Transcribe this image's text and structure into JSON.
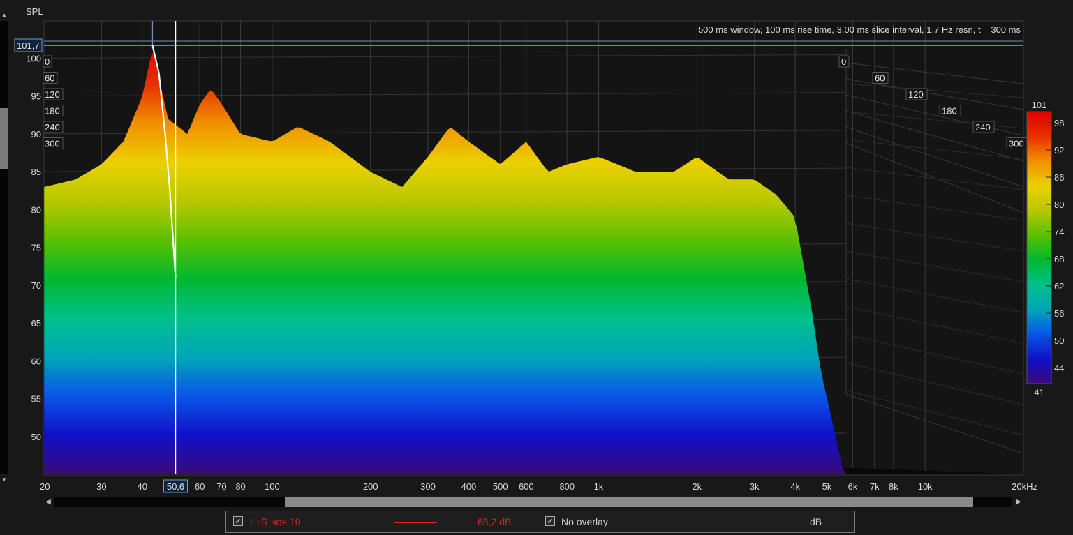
{
  "chart_data": {
    "type": "waterfall",
    "subtype": "3D spectral decay (area)",
    "yaxis_label": "SPL",
    "info_text": "500 ms window, 100 ms rise time, 3,00 ms slice interval, 1,7 Hz resn, t = 300 ms",
    "xlim": [
      20,
      20000
    ],
    "xscale": "log",
    "x_ticks": [
      {
        "v": 20,
        "t": "20"
      },
      {
        "v": 30,
        "t": "30"
      },
      {
        "v": 40,
        "t": "40"
      },
      {
        "v": 60,
        "t": "60"
      },
      {
        "v": 70,
        "t": "70"
      },
      {
        "v": 80,
        "t": "80"
      },
      {
        "v": 100,
        "t": "100"
      },
      {
        "v": 200,
        "t": "200"
      },
      {
        "v": 300,
        "t": "300"
      },
      {
        "v": 400,
        "t": "400"
      },
      {
        "v": 500,
        "t": "500"
      },
      {
        "v": 600,
        "t": "600"
      },
      {
        "v": 800,
        "t": "800"
      },
      {
        "v": 1000,
        "t": "1k"
      },
      {
        "v": 2000,
        "t": "2k"
      },
      {
        "v": 3000,
        "t": "3k"
      },
      {
        "v": 4000,
        "t": "4k"
      },
      {
        "v": 5000,
        "t": "5k"
      },
      {
        "v": 6000,
        "t": "6k"
      },
      {
        "v": 7000,
        "t": "7k"
      },
      {
        "v": 8000,
        "t": "8k"
      },
      {
        "v": 10000,
        "t": "10k"
      },
      {
        "v": 20000,
        "t": "20kHz"
      }
    ],
    "ylim": [
      45,
      102
    ],
    "y_ticks": [
      50,
      55,
      60,
      65,
      70,
      75,
      80,
      85,
      90,
      95,
      100
    ],
    "time_ticks_ms": [
      0,
      60,
      120,
      180,
      240,
      300
    ],
    "time_tick_labels": [
      "0",
      "60",
      "120",
      "180",
      "240",
      "300"
    ],
    "cursor": {
      "x": "50,6",
      "y": "101,7"
    },
    "cursor_freq_hz": 50.6,
    "cursor_spl": 101.7,
    "colorbar": {
      "min_label": "41",
      "max_label": "101",
      "ticks": [
        "98",
        "92",
        "86",
        "80",
        "74",
        "68",
        "62",
        "56",
        "50",
        "44"
      ],
      "colors": [
        "#3a0a7a",
        "#1010c8",
        "#0a55e8",
        "#00a6b8",
        "#00c08a",
        "#00b830",
        "#5ac000",
        "#b8c800",
        "#ecd000",
        "#f09000",
        "#e83000",
        "#e00000"
      ]
    },
    "front_slice_profile": [
      [
        20,
        83
      ],
      [
        25,
        84
      ],
      [
        30,
        86
      ],
      [
        35,
        89
      ],
      [
        40,
        95
      ],
      [
        43,
        101.5
      ],
      [
        48,
        92
      ],
      [
        55,
        90
      ],
      [
        60,
        94
      ],
      [
        65,
        96
      ],
      [
        70,
        94
      ],
      [
        80,
        90
      ],
      [
        100,
        89
      ],
      [
        120,
        91
      ],
      [
        150,
        89
      ],
      [
        200,
        85
      ],
      [
        250,
        83
      ],
      [
        300,
        87
      ],
      [
        350,
        91
      ],
      [
        400,
        89
      ],
      [
        500,
        86
      ],
      [
        600,
        89
      ],
      [
        700,
        85
      ],
      [
        800,
        86
      ],
      [
        1000,
        87
      ],
      [
        1300,
        85
      ],
      [
        1700,
        85
      ],
      [
        2000,
        87
      ],
      [
        2500,
        84
      ],
      [
        3000,
        84
      ],
      [
        3500,
        82
      ],
      [
        4000,
        79
      ],
      [
        4800,
        60
      ],
      [
        5500,
        52
      ],
      [
        6000,
        46
      ]
    ],
    "peaks_hz": [
      43,
      65,
      90,
      120,
      160,
      240,
      350,
      410,
      600,
      800,
      1100,
      1600,
      2100,
      3200
    ],
    "decay_cursor_trace": [
      [
        43,
        101.7
      ],
      [
        45,
        98
      ],
      [
        47,
        90
      ],
      [
        48.5,
        83
      ],
      [
        49.5,
        77
      ],
      [
        50.6,
        71
      ]
    ]
  },
  "legend_bar": {
    "measurement_name": "L+R ноя 10",
    "measurement_value": "68,2 dB",
    "measurement_color": "#e02020",
    "overlay_label": "No overlay",
    "unit_label": "dB"
  },
  "icons": {
    "checkbox": "checkmark-icon",
    "scroll_left": "triangle-left-icon",
    "scroll_right": "triangle-right-icon",
    "scroll_up": "triangle-up-icon",
    "scroll_down": "triangle-down-icon"
  }
}
